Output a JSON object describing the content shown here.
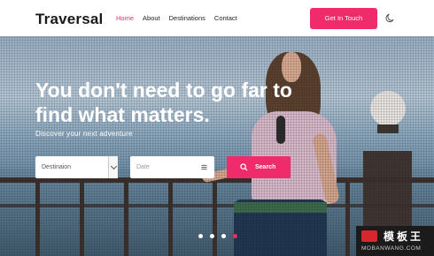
{
  "header": {
    "logo": "Traversal",
    "nav": [
      "Home",
      "About",
      "Destinations",
      "Contact"
    ],
    "active_nav": "Home",
    "cta_label": "Get In Touch",
    "theme_toggle_icon": "moon-icon"
  },
  "hero": {
    "headline": "You don't need to go far to find what matters.",
    "subtitle": "Discover your next adventure"
  },
  "search": {
    "destination_value": "Destinaion",
    "date_placeholder": "Date",
    "date_icon": "calendar-icon",
    "button_label": "Search",
    "button_icon": "search-icon"
  },
  "carousel": {
    "slides": 4,
    "active_slide": 4
  },
  "watermark": {
    "chinese": "模板王",
    "url": "MOBANWANG.COM"
  },
  "colors": {
    "accent": "#ef2b6b",
    "text_dark": "#1a1a1a"
  }
}
